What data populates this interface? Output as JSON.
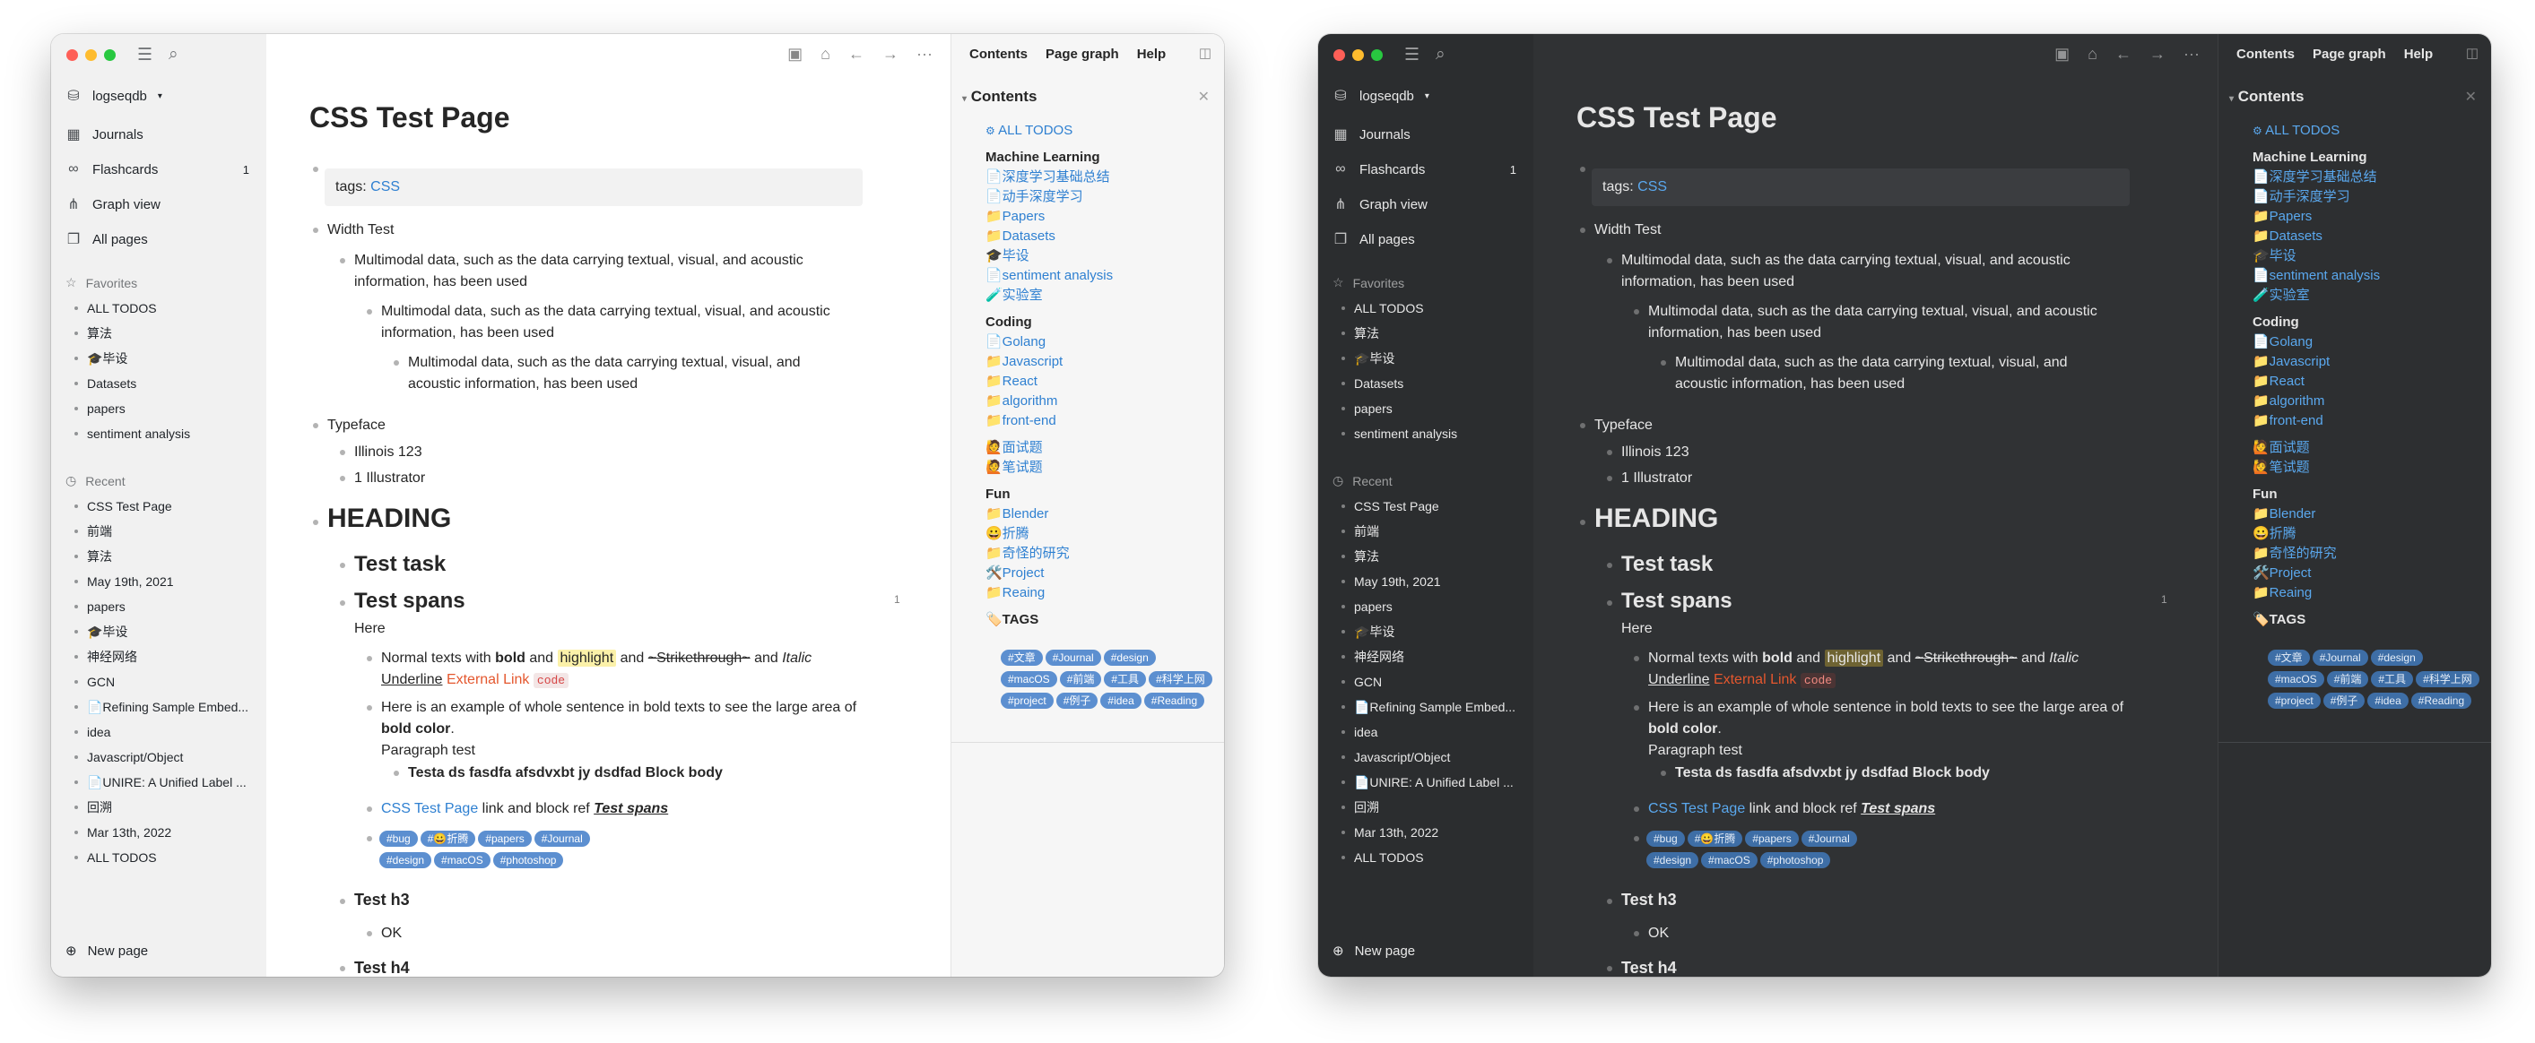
{
  "app": {
    "workspace": "logseqdb",
    "nav": [
      {
        "label": "Journals",
        "icon": "calendar-icon",
        "count": ""
      },
      {
        "label": "Flashcards",
        "icon": "infinity-icon",
        "count": "1"
      },
      {
        "label": "Graph view",
        "icon": "graph-icon",
        "count": ""
      },
      {
        "label": "All pages",
        "icon": "pages-icon",
        "count": ""
      }
    ],
    "favorites_label": "Favorites",
    "favorites": [
      "ALL TODOS",
      "算法",
      "🎓毕设",
      "Datasets",
      "papers",
      "sentiment analysis"
    ],
    "recent_label": "Recent",
    "recent": [
      "CSS Test Page",
      "前端",
      "算法",
      "May 19th, 2021",
      "papers",
      "🎓毕设",
      "神经网络",
      "GCN",
      "📄Refining Sample Embed...",
      "idea",
      "Javascript/Object",
      "📄UNIRE: A Unified Label ...",
      "回溯",
      "Mar 13th, 2022",
      "ALL TODOS"
    ],
    "new_page": "New page"
  },
  "page": {
    "title": "CSS Test Page",
    "tags_label": "tags:",
    "tags_value": "CSS",
    "width_test": "Width Test",
    "multimodal_l1a": "Multimodal data, such as the data carrying textual, visual, and acoustic",
    "multimodal_l1b": "information, has been used",
    "multimodal_l2a": "Multimodal data, such as the data carrying textual, visual, and acoustic",
    "multimodal_l2b": "information, has been used",
    "multimodal_l3a": "Multimodal data, such as the data carrying textual, visual, and",
    "multimodal_l3b": "acoustic information, has been used",
    "typeface": "Typeface",
    "illinois": "Illinois 123",
    "illustrator": "1 Illustrator",
    "heading": "HEADING",
    "test_task": "Test task",
    "test_spans": "Test spans",
    "spans_count": "1",
    "here": "Here",
    "normal_texts": "Normal texts with",
    "bold": "bold",
    "and1": "and",
    "highlight": "highlight",
    "and2": "and",
    "strike": "~Strikethrough~",
    "and3": "and",
    "italic": "Italic",
    "underline": "Underline",
    "external_link": "External Link",
    "code": "code",
    "example_a": "Here is an example of whole sentence in bold texts to see the large area of",
    "example_b": "bold color",
    "example_period": ".",
    "paragraph": "Paragraph test",
    "testa": "Testa ds fasdfa afsdvxbt jy dsdfad Block body",
    "css_link": "CSS Test Page",
    "link_rest": "link and block ref",
    "block_ref": "Test spans",
    "tags_row1": [
      "#bug",
      "#😀折腾",
      "#papers",
      "#Journal"
    ],
    "tags_row2": [
      "#design",
      "#macOS",
      "#photoshop"
    ],
    "test_h3": "Test h3",
    "ok": "OK",
    "test_h4": "Test h4"
  },
  "right_panel": {
    "tabs": [
      "Contents",
      "Page graph",
      "Help"
    ],
    "heading": "Contents",
    "all_todos": "ALL TODOS",
    "sections": [
      {
        "title": "Machine Learning",
        "items": [
          "📄深度学习基础总结",
          "📄动手深度学习",
          "📁Papers",
          "📁Datasets",
          "🎓毕设",
          "📄sentiment analysis",
          "🧪实验室"
        ]
      },
      {
        "title": "Coding",
        "items": [
          "📄Golang",
          "📁Javascript",
          "📁React",
          "📁algorithm",
          "📁front-end"
        ]
      },
      {
        "title": "",
        "items": [
          "🙋面试题",
          "🙋笔试题"
        ]
      },
      {
        "title": "Fun",
        "items": [
          "📁Blender",
          "😀折腾",
          "📁奇怪的研究",
          "🛠️Project",
          "📁Reaing"
        ]
      }
    ],
    "tags_title": "🏷️TAGS",
    "tags": [
      "#文章",
      "#Journal",
      "#design",
      "#macOS",
      "#前端",
      "#工具",
      "#科学上网",
      "#project",
      "#例子",
      "#idea",
      "#Reading"
    ]
  },
  "colors": {
    "link": "#2f80d1",
    "external": "#e4572e",
    "tag_bg": "#5c8fd0",
    "highlight": "#fbf1a9"
  }
}
